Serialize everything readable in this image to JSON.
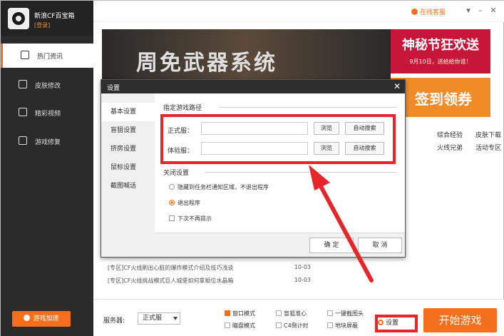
{
  "app": {
    "title": "新浪CF百宝箱",
    "login": "[登录]",
    "online_service": "在线客服"
  },
  "sidebar": {
    "items": [
      {
        "label": "热门资讯",
        "icon": "news-icon"
      },
      {
        "label": "皮肤修改",
        "icon": "shirt-icon"
      },
      {
        "label": "精彩视频",
        "icon": "video-icon"
      },
      {
        "label": "游戏修复",
        "icon": "repair-icon"
      }
    ],
    "accelerate": "游戏加速"
  },
  "banner": {
    "text": "周免武器系统",
    "promo_title": "神秘节狂欢送",
    "promo_sub": "9月10日，送给给你谁！",
    "checkin": "签到领券"
  },
  "quick_links": [
    "综合经验",
    "皮肤下载",
    "火线兄弟",
    "活动专区"
  ],
  "news": [
    {
      "title": "[专区]CF火线刷出心脏的爆炸模式介绍及技巧浅谈",
      "date": "10-03"
    },
    {
      "title": "[专区]CF火线挑战模式巨人城堡如何拿顺位水晶箱",
      "date": "10-03"
    }
  ],
  "bottom": {
    "server_label": "服务器:",
    "server_value": "正式服",
    "options": [
      {
        "label": "窗口模式",
        "checked": true
      },
      {
        "label": "瞄盘模式",
        "checked": false
      },
      {
        "label": "盲狙准心",
        "checked": false
      },
      {
        "label": "C4倒计时",
        "checked": false
      },
      {
        "label": "一键截图头",
        "checked": false
      },
      {
        "label": "地块屏蔽",
        "checked": false
      }
    ],
    "settings": "设置",
    "start": "开始游戏"
  },
  "dialog": {
    "title": "设置",
    "nav": [
      "基本设置",
      "盲狙设置",
      "挤房设置",
      "鼠标设置",
      "截图喊话"
    ],
    "path_section": "指定游戏路径",
    "rows": [
      {
        "label": "正式服：",
        "value": "",
        "browse": "浏览",
        "auto": "自动搜索"
      },
      {
        "label": "体验服：",
        "value": "",
        "browse": "浏览",
        "auto": "自动搜索"
      }
    ],
    "close_section": "关闭设置",
    "radio_minimize": "隐藏到任务栏通知区域，不退出程序",
    "radio_exit": "退出程序",
    "no_prompt": "下次不再提示",
    "ok": "确 定",
    "cancel": "取 消"
  },
  "colors": {
    "accent": "#f36f1b",
    "highlight": "#e5262b",
    "sidebar": "#2b2b2b"
  }
}
